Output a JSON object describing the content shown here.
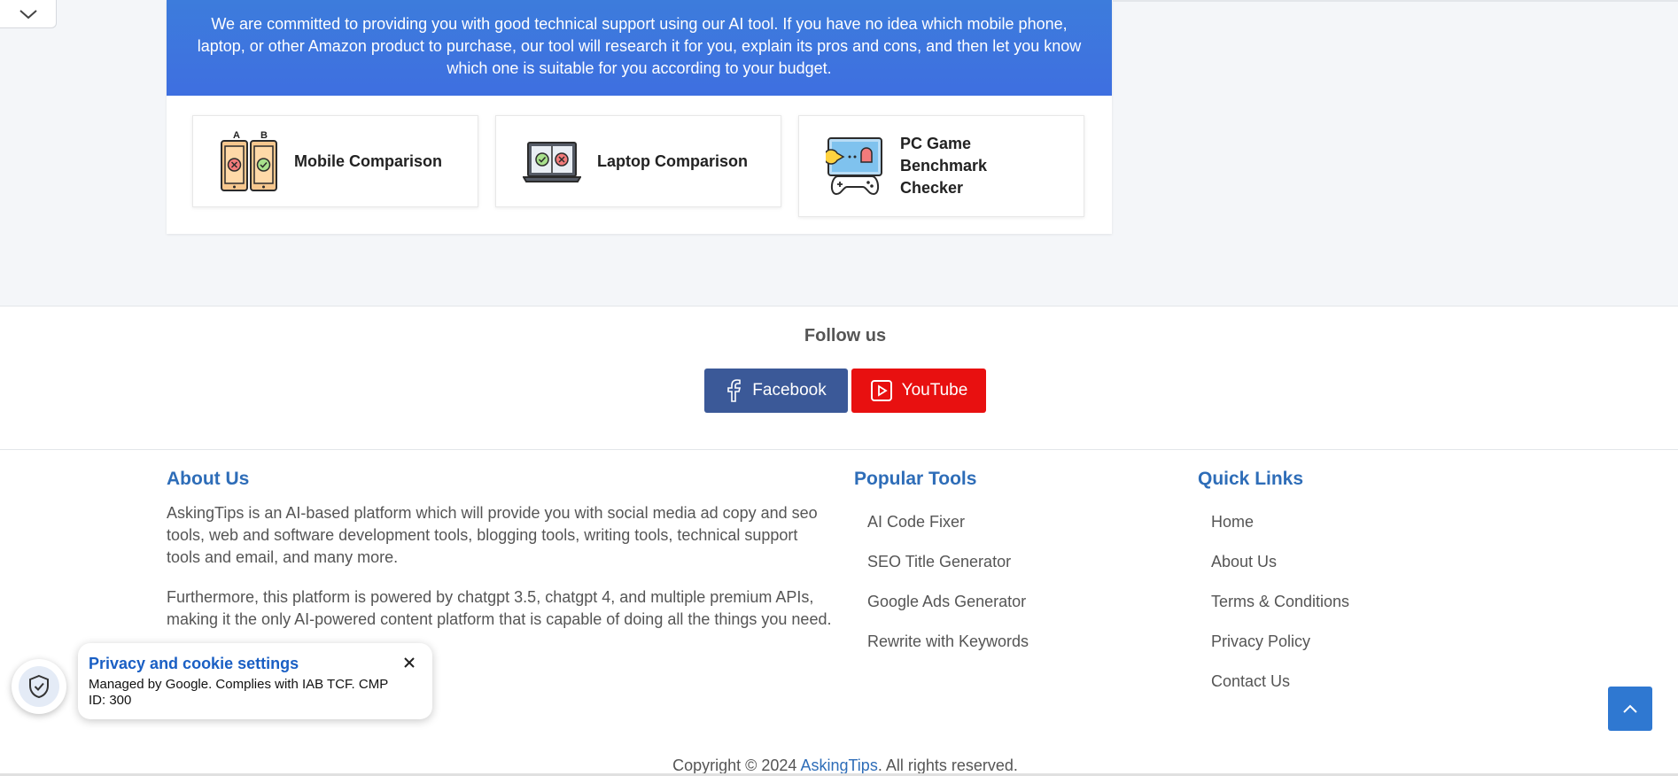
{
  "banner": {
    "text": "We are committed to providing you with good technical support using our AI tool. If you have no idea which mobile phone, laptop, or other Amazon product to purchase, our tool will research it for you, explain its pros and cons, and then let you know which one is suitable for you according to your budget."
  },
  "tools": [
    {
      "label": "Mobile Comparison",
      "icon": "mobile-comparison-icon"
    },
    {
      "label": "Laptop Comparison",
      "icon": "laptop-comparison-icon"
    },
    {
      "label": "PC Game Benchmark Checker",
      "icon": "game-controller-icon"
    }
  ],
  "follow": {
    "title": "Follow us",
    "facebook": "Facebook",
    "youtube": "YouTube",
    "facebook_color": "#3b5998",
    "youtube_color": "#e81010"
  },
  "footer": {
    "about_title": "About Us",
    "about_p1": "AskingTips is an AI-based platform which will provide you with social media ad copy and seo tools, web and software development tools, blogging tools, writing tools, technical support tools and email, and many more.",
    "about_p2": "Furthermore, this platform is powered by chatgpt 3.5, chatgpt 4, and multiple premium APIs, making it the only AI-powered content platform that is capable of doing all the things you need.",
    "popular_title": "Popular Tools",
    "popular_links": [
      "AI Code Fixer",
      "SEO Title Generator",
      "Google Ads Generator",
      "Rewrite with Keywords"
    ],
    "quick_title": "Quick Links",
    "quick_links": [
      "Home",
      "About Us",
      "Terms & Conditions",
      "Privacy Policy",
      "Contact Us"
    ],
    "copyright_prefix": "Copyright © 2024 ",
    "copyright_brand": "AskingTips",
    "copyright_suffix": ". All rights reserved.",
    "heading_color": "#2e6db8"
  },
  "privacy": {
    "title": "Privacy and cookie settings",
    "body": "Managed by Google. Complies with IAB TCF. CMP ID: 300"
  }
}
